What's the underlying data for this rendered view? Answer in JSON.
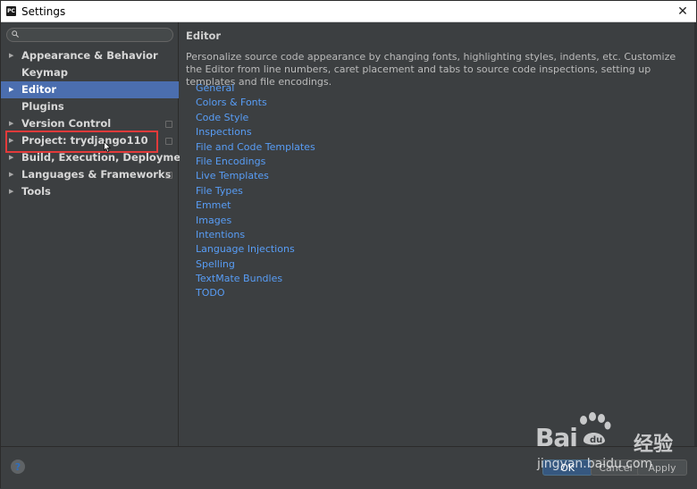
{
  "window": {
    "title": "Settings",
    "app_icon_text": "PC",
    "close_glyph": "✕"
  },
  "search": {
    "placeholder": "",
    "icon": "search-icon"
  },
  "sidebar": {
    "items": [
      {
        "label": "Appearance & Behavior",
        "expandable": true,
        "selected": false,
        "copy_icon": false
      },
      {
        "label": "Keymap",
        "expandable": false,
        "selected": false,
        "copy_icon": false
      },
      {
        "label": "Editor",
        "expandable": true,
        "selected": true,
        "copy_icon": false
      },
      {
        "label": "Plugins",
        "expandable": false,
        "selected": false,
        "copy_icon": false
      },
      {
        "label": "Version Control",
        "expandable": true,
        "selected": false,
        "copy_icon": true
      },
      {
        "label": "Project: trydjango110",
        "expandable": true,
        "selected": false,
        "copy_icon": true
      },
      {
        "label": "Build, Execution, Deployment",
        "expandable": true,
        "selected": false,
        "copy_icon": false
      },
      {
        "label": "Languages & Frameworks",
        "expandable": true,
        "selected": false,
        "copy_icon": true
      },
      {
        "label": "Tools",
        "expandable": true,
        "selected": false,
        "copy_icon": false
      }
    ]
  },
  "content": {
    "title": "Editor",
    "description": "Personalize source code appearance by changing fonts, highlighting styles, indents, etc. Customize the Editor from line numbers, caret placement and tabs to source code inspections, setting up templates and file encodings.",
    "links": [
      "General",
      "Colors & Fonts",
      "Code Style",
      "Inspections",
      "File and Code Templates",
      "File Encodings",
      "Live Templates",
      "File Types",
      "Emmet",
      "Images",
      "Intentions",
      "Language Injections",
      "Spelling",
      "TextMate Bundles",
      "TODO"
    ]
  },
  "footer": {
    "help_label": "?",
    "ok_label": "OK",
    "cancel_label": "Cancel",
    "apply_label": "Apply"
  },
  "watermark": {
    "logo": "Bai",
    "logo_tail": "",
    "cn": "经验",
    "url": "jingyan.baidu.com"
  },
  "colors": {
    "background": "#3c3f41",
    "selection": "#4b6eaf",
    "link": "#589df6",
    "highlight_box": "#e23a3a"
  }
}
